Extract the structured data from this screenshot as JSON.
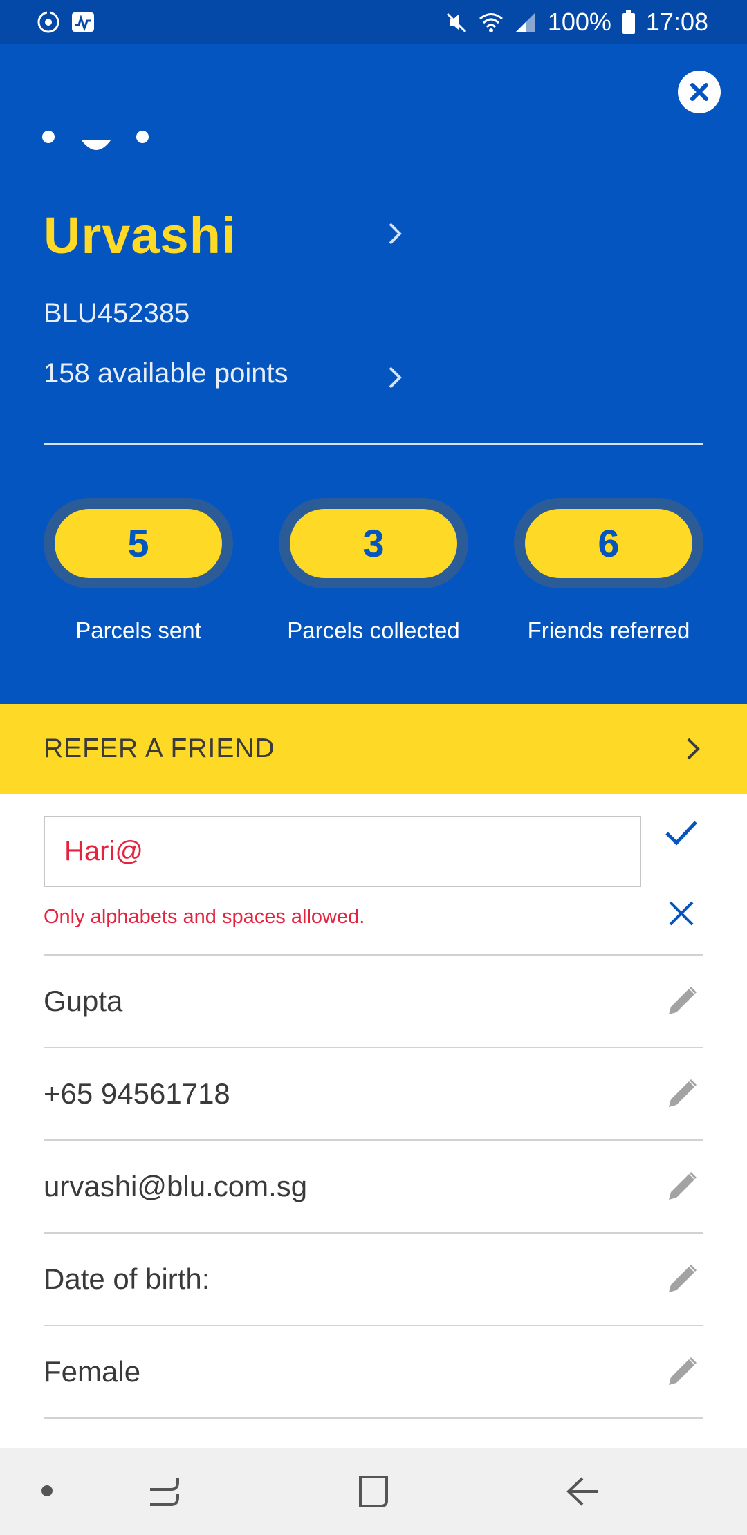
{
  "status_bar": {
    "battery": "100%",
    "time": "17:08",
    "icons": [
      "sync-icon",
      "activity-icon",
      "mute-icon",
      "wifi-icon",
      "signal-icon",
      "battery-icon"
    ]
  },
  "profile": {
    "name": "Urvashi",
    "member_id": "BLU452385",
    "points_text": "158 available points"
  },
  "stats": [
    {
      "value": "5",
      "label": "Parcels sent"
    },
    {
      "value": "3",
      "label": "Parcels collected"
    },
    {
      "value": "6",
      "label": "Friends referred"
    }
  ],
  "refer": {
    "label": "REFER A FRIEND"
  },
  "form": {
    "first_name_value": "Hari@",
    "error": "Only alphabets and spaces allowed.",
    "fields": [
      {
        "value": "Gupta"
      },
      {
        "value": "+65 94561718"
      },
      {
        "value": "urvashi@blu.com.sg"
      },
      {
        "value": "Date of birth:"
      },
      {
        "value": "Female"
      }
    ]
  },
  "colors": {
    "brand_blue": "#0455bf",
    "brand_yellow": "#fed925",
    "error_red": "#e5233f"
  }
}
